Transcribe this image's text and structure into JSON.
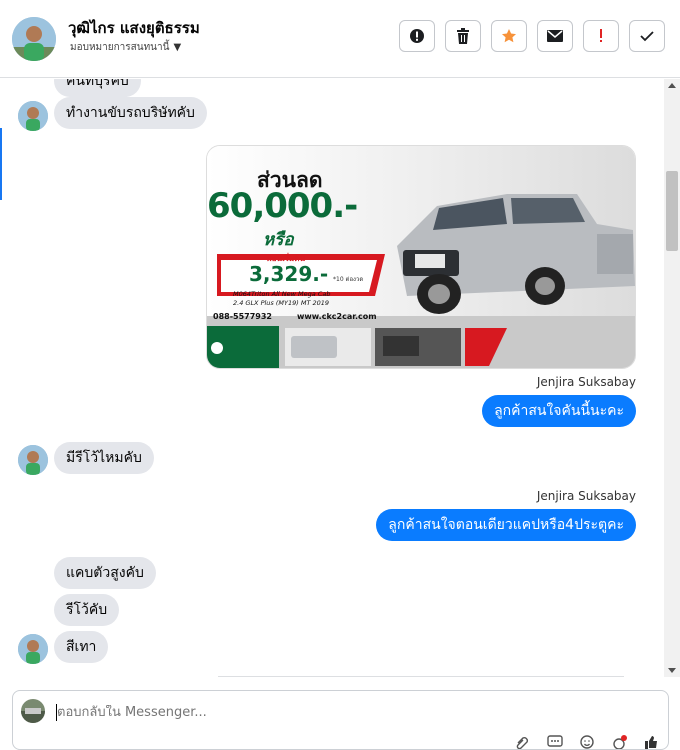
{
  "header": {
    "name": "วุฒิไกร แสงยุติธรรม",
    "assign_label": "มอบหมายการสนทนานี้",
    "actions": [
      {
        "icon": "exclamation-circle-icon"
      },
      {
        "icon": "trash-icon"
      },
      {
        "icon": "star-icon"
      },
      {
        "icon": "envelope-icon"
      },
      {
        "icon": "exclamation-icon"
      },
      {
        "icon": "check-icon"
      }
    ]
  },
  "messages": {
    "m0": "คนที่บุรีคับ",
    "m1": "ทำงานขับรถบริษัทคับ",
    "sender1": "Jenjira Suksabay",
    "m2": "ลูกค้าสนใจคันนี้นะคะ",
    "m3": "มีรีโว้ไหมคับ",
    "sender2": "Jenjira Suksabay",
    "m4": "ลูกค้าสนใจตอนเดียวแคปหรือ4ประตูคะ",
    "m5": "แคบตัวสูงคับ",
    "m6": "รีโว้คับ",
    "m7": "สีเทา"
  },
  "ad": {
    "discount_label": "ส่วนลด",
    "discount_value": "60,000.-",
    "or_label": "หรือ",
    "installment_label": "ผ่อนเริ่มต้น",
    "installment_value": "3,329.-",
    "installment_note": "*10 ต่องวด",
    "model_line1": "M064Triton All New Mega Cab",
    "model_line2": "2.4 GLX Plus (MY19) MT 2019",
    "phone": "088-5577932",
    "website": "www.ckc2car.com"
  },
  "composer": {
    "placeholder": "ตอบกลับใน Messenger..."
  },
  "colors": {
    "accent": "#0a7cff",
    "incoming_bubble": "#e4e6eb",
    "star": "#f7923a",
    "flag": "#e02424"
  }
}
